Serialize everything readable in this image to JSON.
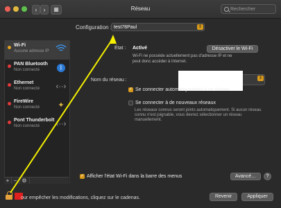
{
  "window": {
    "title": "Réseau",
    "search_placeholder": "Rechercher",
    "back_glyph": "‹",
    "forward_glyph": "›",
    "grid_glyph": "▦"
  },
  "config": {
    "label": "Configuration :",
    "value": "test78Paul"
  },
  "services": [
    {
      "name": "Wi-Fi",
      "status": "Aucune adresse IP",
      "dot": "#e0a020",
      "icon": "wifi-icon"
    },
    {
      "name": "PAN Bluetooth",
      "status": "Non connecté",
      "dot": "#e23b3b",
      "icon": "bluetooth-icon"
    },
    {
      "name": "Ethernet",
      "status": "Non connecté",
      "dot": "#e23b3b",
      "icon": "ethernet-icon"
    },
    {
      "name": "FireWire",
      "status": "Non connecté",
      "dot": "#e23b3b",
      "icon": "firewire-icon"
    },
    {
      "name": "Pont Thunderbolt",
      "status": "Non connecté",
      "dot": "#e23b3b",
      "icon": "thunderbolt-bridge-icon"
    }
  ],
  "sidebar_buttons": {
    "add": "+",
    "remove": "−",
    "gear": "⚙"
  },
  "detail": {
    "status_label": "État :",
    "status_value": "Activé",
    "toggle_button": "Désactiver le Wi-Fi",
    "status_description": "Wi-Fi ne possède actuellement pas d'adresse IP et ne peut donc accéder à Internet.",
    "network_name_label": "Nom du réseau :",
    "auto_join_label": "Se connecter automatiquement à ce réseau",
    "new_networks_label": "Se connecter à de nouveaux réseaux",
    "note": "Les réseaux connus seront joints automatiquement. Si aucun réseau connu n'est joignable, vous devrez sélectionner un réseau manuellement.",
    "menu_bar_label": "Afficher l'état Wi-Fi dans la barre des menus",
    "advanced_button": "Avancé…",
    "help_glyph": "?"
  },
  "footer": {
    "lock_text": "our empêcher les modifications, cliquez sur le cadenas.",
    "revert_button": "Revenir",
    "apply_button": "Appliquer"
  },
  "colors": {
    "accent": "#d89a1a",
    "annotation_arrow": "#f5f000",
    "redaction": "#e21f1f"
  }
}
